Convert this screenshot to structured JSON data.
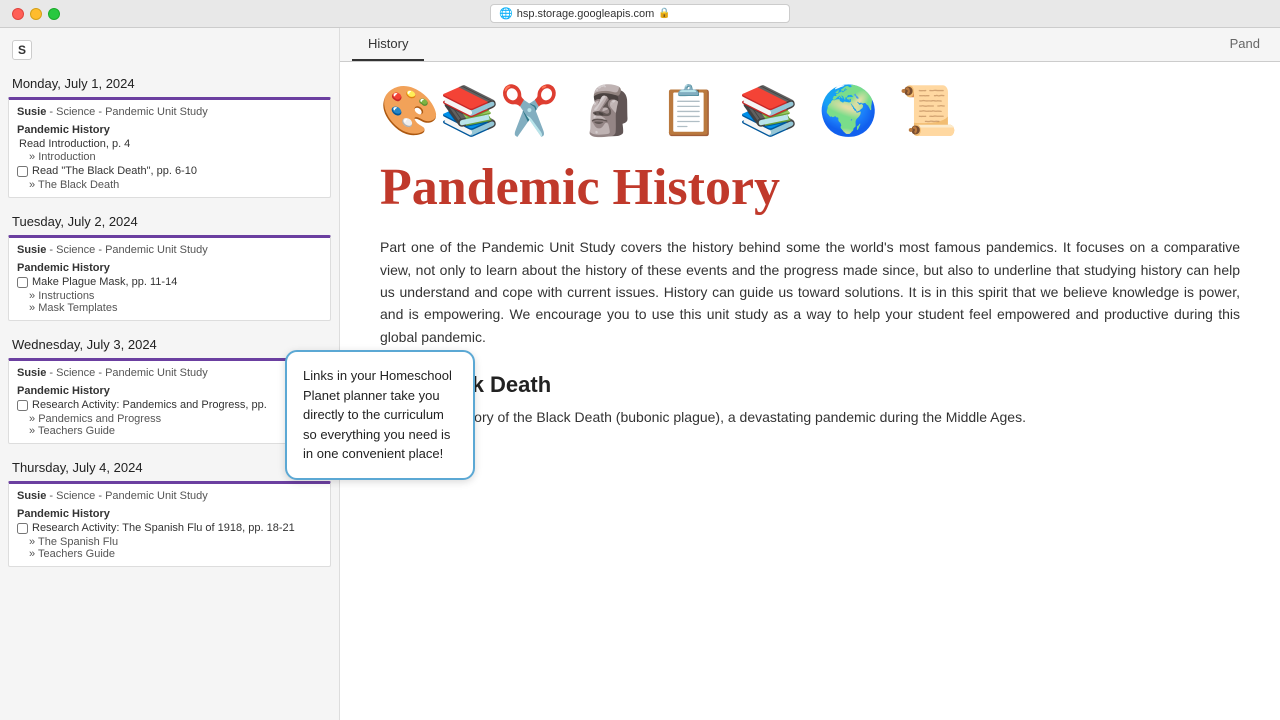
{
  "window": {
    "url": "hsp.storage.googleapis.com",
    "traffic_lights": {
      "red_label": "close",
      "yellow_label": "minimize",
      "green_label": "maximize"
    }
  },
  "sidebar": {
    "s_badge": "S",
    "days": [
      {
        "label": "Monday, July 1, 2024",
        "cards": [
          {
            "student": "Susie",
            "subject": "Science - Pandemic Unit Study",
            "activity_title": "Pandemic History",
            "items": [
              {
                "type": "text",
                "text": "Read Introduction, p. 4"
              },
              {
                "type": "sub",
                "text": "Introduction"
              },
              {
                "type": "checkbox",
                "text": "Read \"The Black Death\", pp. 6-10"
              },
              {
                "type": "sub",
                "text": "The Black Death"
              }
            ]
          }
        ]
      },
      {
        "label": "Tuesday, July 2, 2024",
        "cards": [
          {
            "student": "Susie",
            "subject": "Science - Pandemic Unit Study",
            "activity_title": "Pandemic History",
            "items": [
              {
                "type": "checkbox",
                "text": "Make Plague Mask, pp. 11-14"
              },
              {
                "type": "sub",
                "text": "Instructions"
              },
              {
                "type": "sub",
                "text": "Mask Templates"
              }
            ]
          }
        ]
      },
      {
        "label": "Wednesday, July 3, 2024",
        "cards": [
          {
            "student": "Susie",
            "subject": "Science - Pandemic Unit Study",
            "activity_title": "Pandemic History",
            "items": [
              {
                "type": "checkbox",
                "text": "Research Activity: Pandemics and Progress, pp."
              },
              {
                "type": "sub",
                "text": "Pandemics and Progress"
              },
              {
                "type": "sub",
                "text": "Teachers Guide"
              }
            ]
          }
        ]
      },
      {
        "label": "Thursday, July 4, 2024",
        "cards": [
          {
            "student": "Susie",
            "subject": "Science - Pandemic Unit Study",
            "activity_title": "Pandemic History",
            "items": [
              {
                "type": "checkbox",
                "text": "Research Activity: The Spanish Flu of 1918, pp. 18-21"
              },
              {
                "type": "sub",
                "text": "The Spanish Flu"
              },
              {
                "type": "sub",
                "text": "Teachers Guide"
              }
            ]
          }
        ]
      }
    ]
  },
  "web": {
    "tab_history": "History",
    "tab_pand": "Pand",
    "main_title": "Pandemic History",
    "intro_text": "Part one of the Pandemic Unit Study covers the history behind some the world's most famous pandemics. It focuses on a comparative view, not only to learn about the history of these events and the progress made since, but also to underline that studying history can help us understand and cope with current issues. History can guide us toward solutions. It is in this spirit that we believe knowledge is power, and is empowering. We encourage you to use this unit study as a way to help your student feel empowered and productive during this global pandemic.",
    "section1_title": "The Black Death",
    "section1_text": "A read-aloud story of the Black Death (bubonic plague), a devastating pandemic during the Middle Ages."
  },
  "callout": {
    "text": "Links in your Homeschool Planet planner take you directly to the curriculum so everything you need is in one convenient place!"
  },
  "icons": [
    {
      "name": "arts-crafts",
      "symbol": "🎨"
    },
    {
      "name": "thinker-statue",
      "symbol": "🗿"
    },
    {
      "name": "clipboard-writing",
      "symbol": "📋"
    },
    {
      "name": "books-stack",
      "symbol": "📚"
    },
    {
      "name": "globe",
      "symbol": "🌍"
    },
    {
      "name": "scroll",
      "symbol": "📜"
    }
  ]
}
